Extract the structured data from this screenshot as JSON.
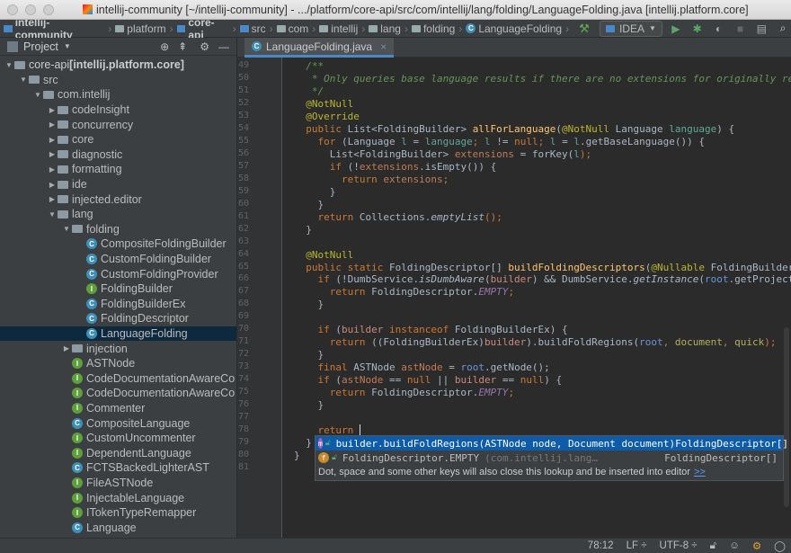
{
  "window": {
    "title": "intellij-community [~/intellij-community] - .../platform/core-api/src/com/intellij/lang/folding/LanguageFolding.java [intellij.platform.core]"
  },
  "navbar": {
    "crumbs": [
      {
        "label": "intellij-community",
        "bold": true,
        "icon": "module"
      },
      {
        "label": "platform",
        "icon": "folder"
      },
      {
        "label": "core-api",
        "bold": true,
        "icon": "module"
      },
      {
        "label": "src",
        "icon": "source-folder"
      },
      {
        "label": "com",
        "icon": "package"
      },
      {
        "label": "intellij",
        "icon": "package"
      },
      {
        "label": "lang",
        "icon": "package"
      },
      {
        "label": "folding",
        "icon": "package"
      },
      {
        "label": "LanguageFolding",
        "icon": "class"
      }
    ],
    "run_config": "IDEA"
  },
  "project_panel": {
    "title": "Project",
    "tree": [
      {
        "label": "core-api",
        "suffix": " [intellij.platform.core]",
        "level": 0,
        "expanded": true,
        "icon": "folder",
        "bold": true
      },
      {
        "label": "src",
        "level": 1,
        "expanded": true,
        "icon": "folder"
      },
      {
        "label": "com.intellij",
        "level": 2,
        "expanded": true,
        "icon": "folder"
      },
      {
        "label": "codeInsight",
        "level": 3,
        "expanded": false,
        "icon": "folder"
      },
      {
        "label": "concurrency",
        "level": 3,
        "expanded": false,
        "icon": "folder"
      },
      {
        "label": "core",
        "level": 3,
        "expanded": false,
        "icon": "folder"
      },
      {
        "label": "diagnostic",
        "level": 3,
        "expanded": false,
        "icon": "folder"
      },
      {
        "label": "formatting",
        "level": 3,
        "expanded": false,
        "icon": "folder"
      },
      {
        "label": "ide",
        "level": 3,
        "expanded": false,
        "icon": "folder"
      },
      {
        "label": "injected.editor",
        "level": 3,
        "expanded": false,
        "icon": "folder"
      },
      {
        "label": "lang",
        "level": 3,
        "expanded": true,
        "icon": "folder"
      },
      {
        "label": "folding",
        "level": 4,
        "expanded": true,
        "icon": "folder"
      },
      {
        "label": "CompositeFoldingBuilder",
        "level": 5,
        "icon": "class"
      },
      {
        "label": "CustomFoldingBuilder",
        "level": 5,
        "icon": "class"
      },
      {
        "label": "CustomFoldingProvider",
        "level": 5,
        "icon": "class"
      },
      {
        "label": "FoldingBuilder",
        "level": 5,
        "icon": "interface"
      },
      {
        "label": "FoldingBuilderEx",
        "level": 5,
        "icon": "class"
      },
      {
        "label": "FoldingDescriptor",
        "level": 5,
        "icon": "class"
      },
      {
        "label": "LanguageFolding",
        "level": 5,
        "icon": "class",
        "selected": true
      },
      {
        "label": "injection",
        "level": 4,
        "expanded": false,
        "icon": "folder"
      },
      {
        "label": "ASTNode",
        "level": 4,
        "icon": "interface"
      },
      {
        "label": "CodeDocumentationAwareCo",
        "level": 4,
        "icon": "interface"
      },
      {
        "label": "CodeDocumentationAwareCo",
        "level": 4,
        "icon": "interface"
      },
      {
        "label": "Commenter",
        "level": 4,
        "icon": "interface"
      },
      {
        "label": "CompositeLanguage",
        "level": 4,
        "icon": "class"
      },
      {
        "label": "CustomUncommenter",
        "level": 4,
        "icon": "interface"
      },
      {
        "label": "DependentLanguage",
        "level": 4,
        "icon": "interface"
      },
      {
        "label": "FCTSBackedLighterAST",
        "level": 4,
        "icon": "class"
      },
      {
        "label": "FileASTNode",
        "level": 4,
        "icon": "interface"
      },
      {
        "label": "InjectableLanguage",
        "level": 4,
        "icon": "interface"
      },
      {
        "label": "ITokenTypeRemapper",
        "level": 4,
        "icon": "interface"
      },
      {
        "label": "Language",
        "level": 4,
        "icon": "class"
      }
    ]
  },
  "editor": {
    "tab": "LanguageFolding.java",
    "first_line": 49,
    "lines": [
      [
        [
          "  /**",
          "c"
        ]
      ],
      [
        [
          "   * Only queries base language results if there are no extensions for originally requested",
          "c"
        ]
      ],
      [
        [
          "   */",
          "c"
        ]
      ],
      [
        [
          "  @NotNull",
          "a"
        ]
      ],
      [
        [
          "  @Override",
          "a"
        ]
      ],
      [
        [
          "  public ",
          "k"
        ],
        [
          "List<FoldingBuilder> ",
          ""
        ],
        [
          "allForLanguage",
          "f"
        ],
        [
          "(",
          ""
        ],
        [
          "@NotNull ",
          "a"
        ],
        [
          "Language ",
          ""
        ],
        [
          "language",
          "p"
        ],
        [
          ") {",
          ""
        ]
      ],
      [
        [
          "    for ",
          "k"
        ],
        [
          "(Language ",
          ""
        ],
        [
          "l",
          "p"
        ],
        [
          " = ",
          ""
        ],
        [
          "language",
          "p"
        ],
        [
          "; ",
          "k"
        ],
        [
          "l",
          "p"
        ],
        [
          " != ",
          ""
        ],
        [
          "null",
          "k"
        ],
        [
          "; ",
          "k"
        ],
        [
          "l",
          "p"
        ],
        [
          " = ",
          ""
        ],
        [
          "l",
          "p"
        ],
        [
          ".getBaseLanguage()) {",
          ""
        ]
      ],
      [
        [
          "      List<FoldingBuilder> ",
          ""
        ],
        [
          "extensions",
          "r"
        ],
        [
          " = forKey(",
          ""
        ],
        [
          "l",
          "p"
        ],
        [
          ");",
          "k"
        ]
      ],
      [
        [
          "      if ",
          "k"
        ],
        [
          "(!",
          ""
        ],
        [
          "extensions",
          "r"
        ],
        [
          ".isEmpty()) {",
          ""
        ]
      ],
      [
        [
          "        return ",
          "k"
        ],
        [
          "extensions",
          "r"
        ],
        [
          ";",
          "k"
        ]
      ],
      [
        [
          "      }",
          ""
        ]
      ],
      [
        [
          "    }",
          ""
        ]
      ],
      [
        [
          "    return ",
          "k"
        ],
        [
          "Collections.",
          ""
        ],
        [
          "emptyList",
          "i"
        ],
        [
          "();",
          "k"
        ]
      ],
      [
        [
          "  }",
          ""
        ]
      ],
      [
        [
          "",
          ""
        ]
      ],
      [
        [
          "  @NotNull",
          "a"
        ]
      ],
      [
        [
          "  public static ",
          "k"
        ],
        [
          "FoldingDescriptor[] ",
          ""
        ],
        [
          "buildFoldingDescriptors",
          "f"
        ],
        [
          "(",
          ""
        ],
        [
          "@Nullable ",
          "a"
        ],
        [
          "FoldingBuilder ",
          ""
        ],
        [
          "builder",
          "b"
        ],
        [
          ", PsiElement root, Document document, boolean quick) {",
          ""
        ]
      ],
      [
        [
          "    if ",
          "k"
        ],
        [
          "(!DumbService.",
          ""
        ],
        [
          "isDumbAware",
          "i"
        ],
        [
          "(",
          ""
        ],
        [
          "builder",
          "b"
        ],
        [
          ") && DumbService.",
          ""
        ],
        [
          "getInstance",
          "i"
        ],
        [
          "(",
          ""
        ],
        [
          "root",
          "o"
        ],
        [
          ".getProject()).isDumb()) {",
          ""
        ]
      ],
      [
        [
          "      return ",
          "k"
        ],
        [
          "FoldingDescriptor.",
          ""
        ],
        [
          "EMPTY",
          "v"
        ],
        [
          ";",
          "k"
        ]
      ],
      [
        [
          "    }",
          ""
        ]
      ],
      [
        [
          "",
          ""
        ]
      ],
      [
        [
          "    if ",
          "k"
        ],
        [
          "(",
          ""
        ],
        [
          "builder ",
          "b"
        ],
        [
          "instanceof ",
          "k"
        ],
        [
          "FoldingBuilderEx) {",
          ""
        ]
      ],
      [
        [
          "      return ",
          "k"
        ],
        [
          "((FoldingBuilderEx)",
          ""
        ],
        [
          "builder",
          "b"
        ],
        [
          ").buildFoldRegions(",
          ""
        ],
        [
          "root",
          "o"
        ],
        [
          ", ",
          "k"
        ],
        [
          "document",
          "d"
        ],
        [
          ", ",
          "k"
        ],
        [
          "quick",
          "d"
        ],
        [
          ");",
          "k"
        ]
      ],
      [
        [
          "    }",
          ""
        ]
      ],
      [
        [
          "    final ",
          "k"
        ],
        [
          "ASTNode ",
          ""
        ],
        [
          "astNode",
          "r"
        ],
        [
          " = ",
          ""
        ],
        [
          "root",
          "o"
        ],
        [
          ".getNode();",
          ""
        ]
      ],
      [
        [
          "    if ",
          "k"
        ],
        [
          "(",
          ""
        ],
        [
          "astNode",
          "r"
        ],
        [
          " == ",
          ""
        ],
        [
          "null ",
          "k"
        ],
        [
          "|| ",
          ""
        ],
        [
          "builder",
          "b"
        ],
        [
          " == ",
          ""
        ],
        [
          "null",
          "k"
        ],
        [
          ") {",
          ""
        ]
      ],
      [
        [
          "      return ",
          "k"
        ],
        [
          "FoldingDescriptor.",
          ""
        ],
        [
          "EMPTY",
          "v"
        ],
        [
          ";",
          "k"
        ]
      ],
      [
        [
          "    }",
          ""
        ]
      ],
      [
        [
          "",
          ""
        ]
      ],
      [
        [
          "    return ",
          "k"
        ]
      ],
      [
        [
          "  }",
          ""
        ]
      ],
      [
        [
          "}",
          ""
        ]
      ],
      [
        [
          "",
          ""
        ]
      ]
    ]
  },
  "completion": {
    "items": [
      {
        "icon": "m",
        "icon_color": "#b05dad",
        "text": "builder.buildFoldRegions(ASTNode node, Document document)",
        "detail": "",
        "type": "FoldingDescriptor[]",
        "selected": true
      },
      {
        "icon": "f",
        "icon_color": "#c78a2c",
        "text": "FoldingDescriptor.EMPTY",
        "detail": "(com.intellij.lang…",
        "type": "FoldingDescriptor[]",
        "selected": false
      }
    ],
    "hint": "Dot, space and some other keys will also close this lookup and be inserted into editor",
    "hint_link": ">>"
  },
  "statusbar": {
    "position": "78:12",
    "line_separator": "LF ÷",
    "encoding": "UTF-8 ÷"
  },
  "colors": {
    "selection": "#0d293e",
    "accent": "#4a88c7",
    "popup_selection": "#0d5bab"
  }
}
